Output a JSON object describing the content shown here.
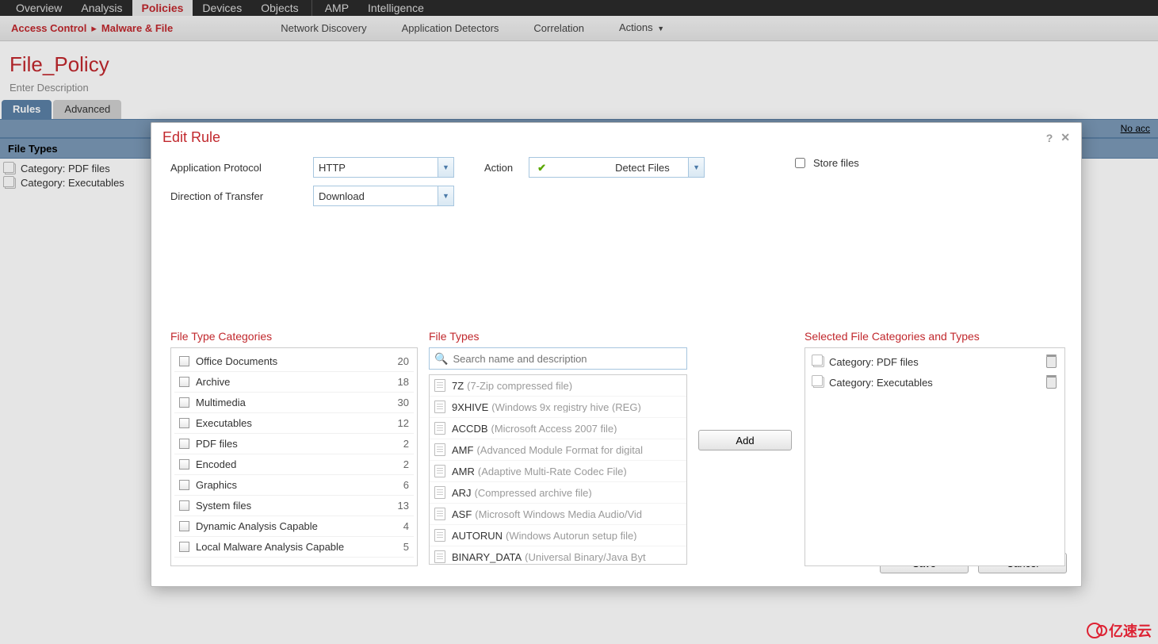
{
  "topnav": {
    "items": [
      "Overview",
      "Analysis",
      "Policies",
      "Devices",
      "Objects",
      "|",
      "AMP",
      "Intelligence"
    ],
    "active": "Policies"
  },
  "subnav": {
    "crumb1": "Access Control",
    "crumb2": "Malware & File",
    "tabs": [
      "Network Discovery",
      "Application Detectors",
      "Correlation",
      "Actions"
    ],
    "actions_has_dropdown": true
  },
  "page": {
    "title": "File_Policy",
    "description": "Enter Description"
  },
  "inner_tabs": {
    "items": [
      "Rules",
      "Advanced"
    ],
    "active": "Rules"
  },
  "blue_bar": {
    "right_link": "No acc"
  },
  "section_header": "File Types",
  "side_categories": [
    "Category: PDF files",
    "Category: Executables"
  ],
  "modal": {
    "title": "Edit Rule",
    "help_tooltip": "?",
    "labels": {
      "app_protocol": "Application Protocol",
      "direction": "Direction of Transfer",
      "action": "Action",
      "store_files": "Store files"
    },
    "values": {
      "app_protocol": "HTTP",
      "direction": "Download",
      "action": "Detect Files",
      "store_files_checked": false
    },
    "panel_titles": {
      "categories": "File Type Categories",
      "types": "File Types",
      "selected": "Selected File Categories and Types"
    },
    "categories": [
      {
        "label": "Office Documents",
        "count": 20
      },
      {
        "label": "Archive",
        "count": 18
      },
      {
        "label": "Multimedia",
        "count": 30
      },
      {
        "label": "Executables",
        "count": 12
      },
      {
        "label": "PDF files",
        "count": 2
      },
      {
        "label": "Encoded",
        "count": 2
      },
      {
        "label": "Graphics",
        "count": 6
      },
      {
        "label": "System files",
        "count": 13
      },
      {
        "label": "Dynamic Analysis Capable",
        "count": 4
      },
      {
        "label": "Local Malware Analysis Capable",
        "count": 5
      }
    ],
    "search_placeholder": "Search name and description",
    "file_types": [
      {
        "name": "7Z",
        "desc": "(7-Zip compressed file)"
      },
      {
        "name": "9XHIVE",
        "desc": "(Windows 9x registry hive (REG)"
      },
      {
        "name": "ACCDB",
        "desc": "(Microsoft Access 2007 file)"
      },
      {
        "name": "AMF",
        "desc": "(Advanced Module Format for digital"
      },
      {
        "name": "AMR",
        "desc": "(Adaptive Multi-Rate Codec File)"
      },
      {
        "name": "ARJ",
        "desc": "(Compressed archive file)"
      },
      {
        "name": "ASF",
        "desc": "(Microsoft Windows Media Audio/Vid"
      },
      {
        "name": "AUTORUN",
        "desc": "(Windows Autorun setup file)"
      },
      {
        "name": "BINARY_DATA",
        "desc": "(Universal Binary/Java Byt"
      }
    ],
    "add_button": "Add",
    "selected": [
      "Category: PDF files",
      "Category: Executables"
    ],
    "buttons": {
      "save": "Save",
      "cancel": "Cancel"
    }
  },
  "watermark": "亿速云"
}
